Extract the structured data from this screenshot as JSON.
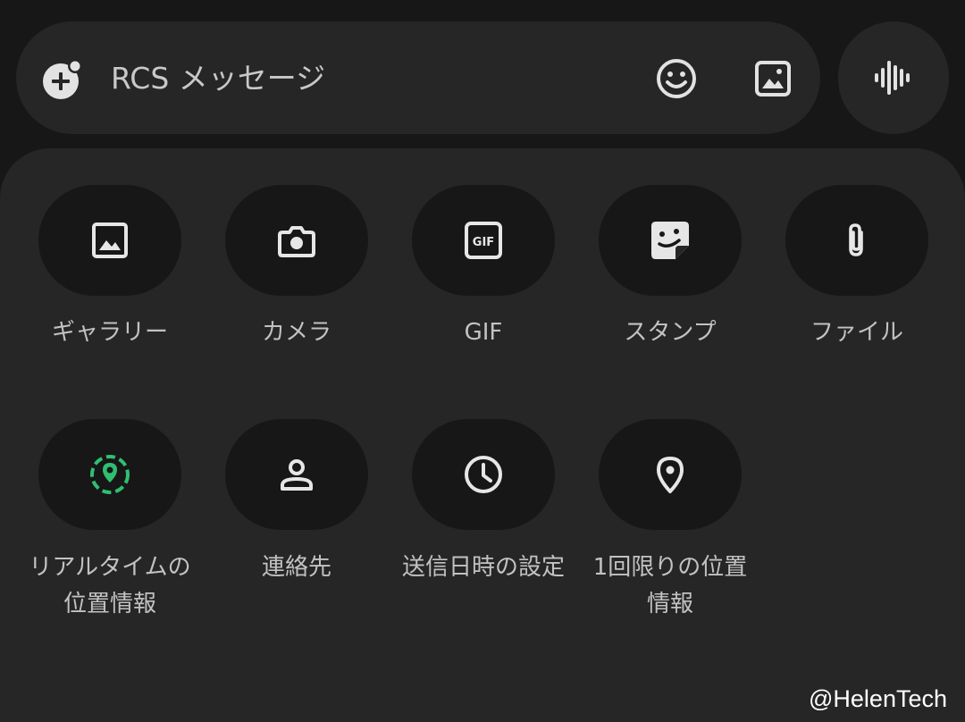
{
  "compose": {
    "placeholder": "RCS メッセージ",
    "icons": [
      "add-circle-icon",
      "emoji-icon",
      "image-icon",
      "voice-waveform-icon"
    ]
  },
  "attachments": {
    "row1": [
      {
        "label": "ギャラリー",
        "icon": "gallery-icon"
      },
      {
        "label": "カメラ",
        "icon": "camera-icon"
      },
      {
        "label": "GIF",
        "icon": "gif-icon"
      },
      {
        "label": "スタンプ",
        "icon": "sticker-icon"
      },
      {
        "label": "ファイル",
        "icon": "paperclip-icon"
      }
    ],
    "row2": [
      {
        "label": "リアルタイムの\n位置情報",
        "icon": "live-location-icon"
      },
      {
        "label": "連絡先",
        "icon": "contact-icon"
      },
      {
        "label": "送信日時の設定",
        "icon": "clock-icon"
      },
      {
        "label": "1回限りの位置\n情報",
        "icon": "location-pin-icon"
      }
    ]
  },
  "colors": {
    "background": "#171717",
    "surface": "#262626",
    "icon": "#e6e6e6",
    "live_location_accent": "#2fbf71"
  },
  "watermark": "@HelenTech"
}
